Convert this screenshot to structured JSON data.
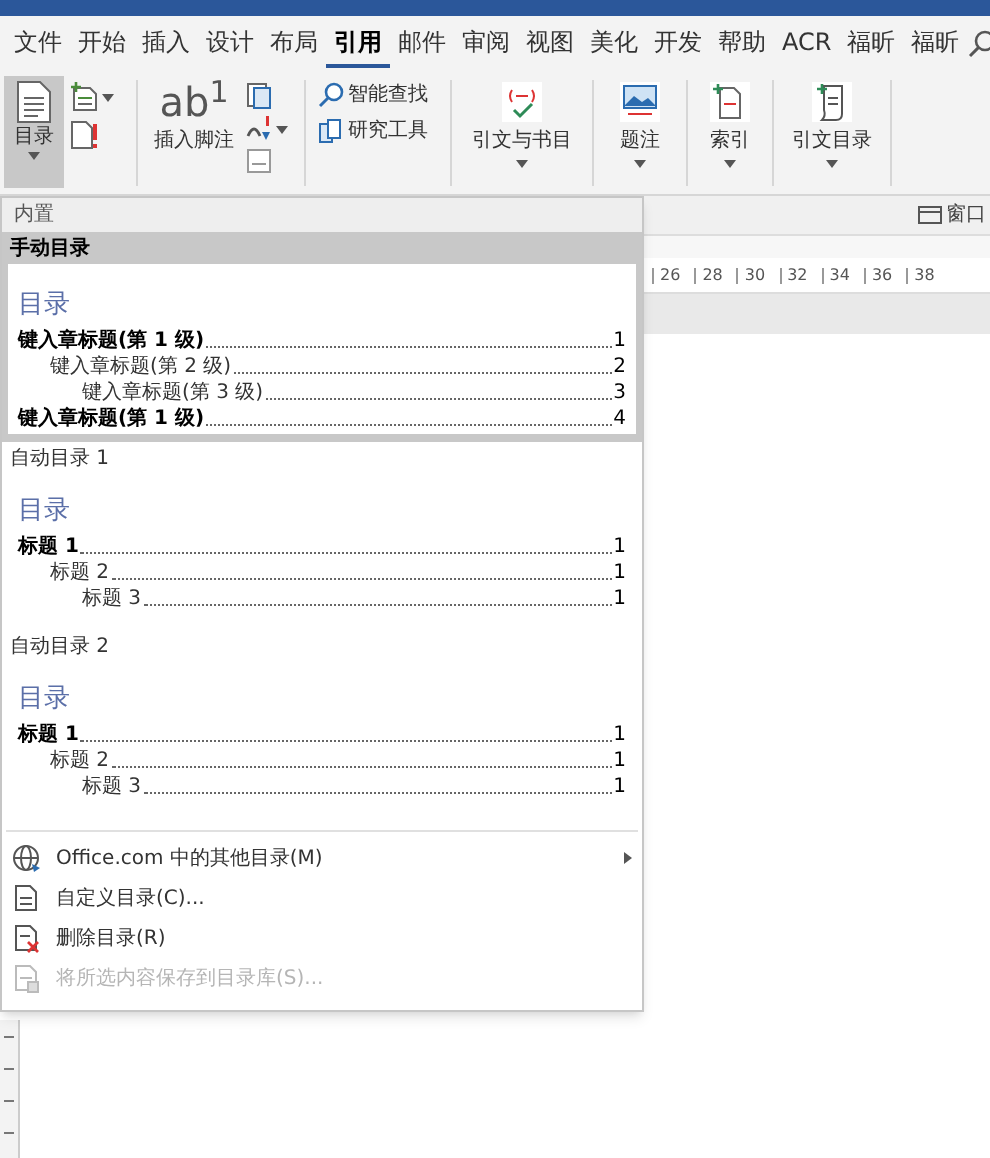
{
  "tabs": [
    {
      "label": "文件",
      "selected": false
    },
    {
      "label": "开始",
      "selected": false
    },
    {
      "label": "插入",
      "selected": false
    },
    {
      "label": "设计",
      "selected": false
    },
    {
      "label": "布局",
      "selected": false
    },
    {
      "label": "引用",
      "selected": true
    },
    {
      "label": "邮件",
      "selected": false
    },
    {
      "label": "审阅",
      "selected": false
    },
    {
      "label": "视图",
      "selected": false
    },
    {
      "label": "美化",
      "selected": false
    },
    {
      "label": "开发",
      "selected": false
    },
    {
      "label": "帮助",
      "selected": false
    },
    {
      "label": "ACR",
      "selected": false
    },
    {
      "label": "福昕",
      "selected": false
    },
    {
      "label": "福昕",
      "selected": false
    }
  ],
  "ribbon": {
    "toc": {
      "label": "目录",
      "pressed": true
    },
    "footnote": {
      "label": "插入脚注",
      "icon_text": "ab$^{1}$"
    },
    "research": [
      "智能查找",
      "研究工具"
    ],
    "large_buttons": [
      {
        "label": "引文与书目"
      },
      {
        "label": "题注"
      },
      {
        "label": "索引"
      },
      {
        "label": "引文目录"
      }
    ]
  },
  "view_bar": {
    "window_label": "窗口"
  },
  "ruler": {
    "numbers": [
      "26",
      "28",
      "30",
      "32",
      "34",
      "36",
      "38"
    ]
  },
  "toc_menu": {
    "header": "内置",
    "gallery": [
      {
        "title": "手动目录",
        "selected": true,
        "heading": "目录",
        "entries": [
          {
            "text": "键入章标题(第 1 级)",
            "page": "1",
            "children": [
              {
                "text": "键入章标题(第 2 级)",
                "page": "2",
                "children": [
                  {
                    "text": "键入章标题(第 3 级)",
                    "page": "3"
                  }
                ]
              }
            ]
          },
          {
            "text": "键入章标题(第 1 级)",
            "page": "4"
          }
        ]
      },
      {
        "title": "自动目录 1",
        "selected": false,
        "heading": "目录",
        "entries": [
          {
            "text": "标题 1",
            "page": "1",
            "children": [
              {
                "text": "标题 2",
                "page": "1",
                "children": [
                  {
                    "text": "标题 3",
                    "page": "1"
                  }
                ]
              }
            ]
          }
        ]
      },
      {
        "title": "自动目录 2",
        "selected": false,
        "heading": "目录",
        "entries": [
          {
            "text": "标题 1",
            "page": "1",
            "children": [
              {
                "text": "标题 2",
                "page": "1",
                "children": [
                  {
                    "text": "标题 3",
                    "page": "1"
                  }
                ]
              }
            ]
          }
        ]
      }
    ],
    "commands": [
      {
        "label": "Office.com 中的其他目录(M)",
        "submenu": true,
        "disabled": false
      },
      {
        "label": "自定义目录(C)...",
        "submenu": false,
        "disabled": false
      },
      {
        "label": "删除目录(R)",
        "submenu": false,
        "disabled": false
      },
      {
        "label": "将所选内容保存到目录库(S)...",
        "submenu": false,
        "disabled": true
      }
    ]
  }
}
